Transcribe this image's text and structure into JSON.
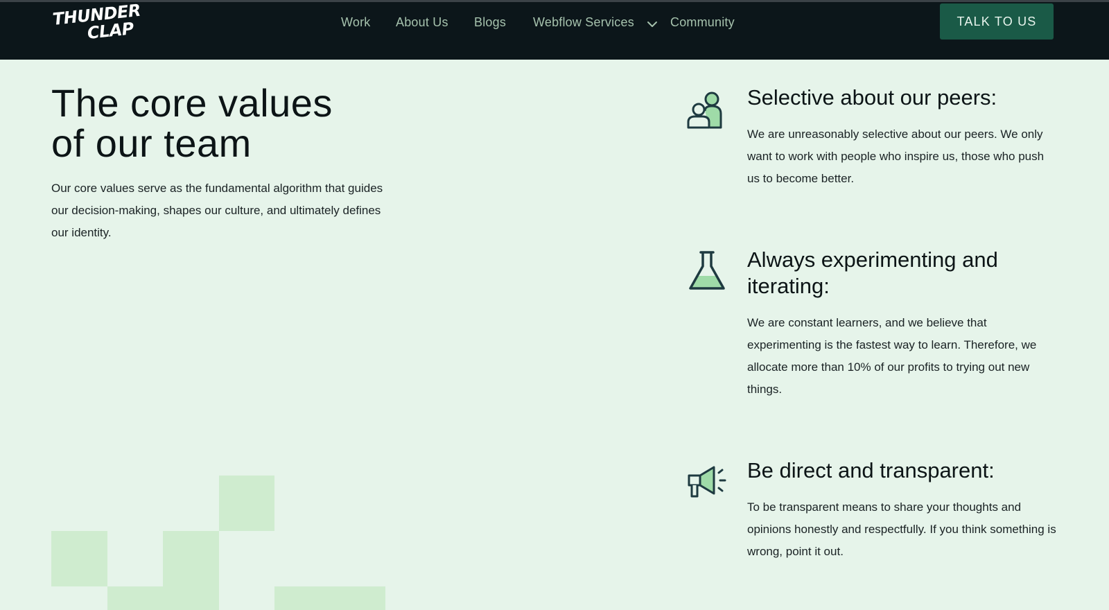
{
  "nav": {
    "logo_line1": "THUNDER",
    "logo_line2": "CLAP",
    "links": [
      "Work",
      "About Us",
      "Blogs",
      "Webflow Services",
      "Community"
    ],
    "cta": "TALK TO US"
  },
  "hero": {
    "title_line1": "The core values",
    "title_line2": "of our team",
    "text": "Our core values serve as the fundamental algorithm that guides our decision-making, shapes our culture, and ultimately defines our identity."
  },
  "values": [
    {
      "icon": "peers-icon",
      "title": "Selective about our peers:",
      "text": "We are unreasonably selective about our peers. We only want to work with people who inspire us, those who push us to become better."
    },
    {
      "icon": "flask-icon",
      "title": "Always experimenting and iterating:",
      "text": "We are constant learners, and we believe that experimenting is the fastest way to learn. Therefore, we allocate more than 10% of our profits to trying out new things."
    },
    {
      "icon": "megaphone-icon",
      "title": "Be direct and transparent:",
      "text": "To be transparent means to share your thoughts and opinions honestly and respectfully. If you think something is wrong, point it out."
    }
  ],
  "colors": {
    "background": "#e6f4ea",
    "nav_background": "#0c161a",
    "accent": "#1a5a47",
    "icon_fill": "#9fdba8"
  }
}
